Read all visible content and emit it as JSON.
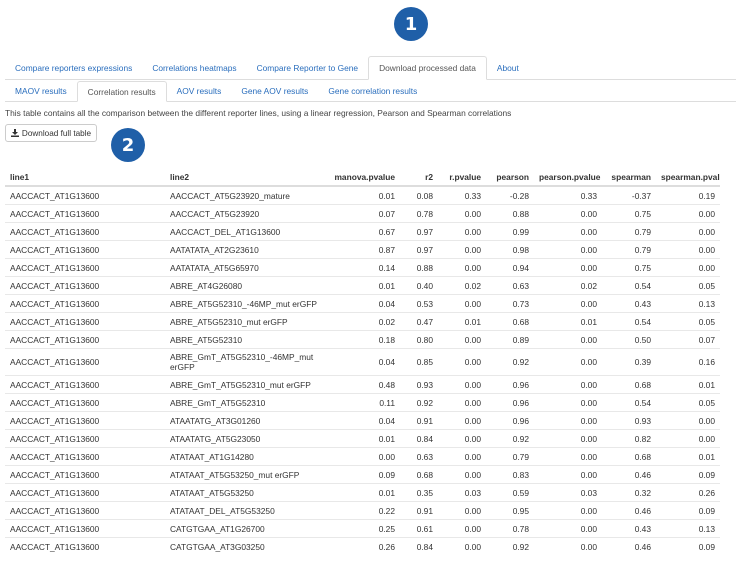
{
  "annotations": [
    "1",
    "2"
  ],
  "top_tabs": [
    {
      "label": "Compare reporters expressions",
      "active": false
    },
    {
      "label": "Correlations heatmaps",
      "active": false
    },
    {
      "label": "Compare Reporter to Gene",
      "active": false
    },
    {
      "label": "Download processed data",
      "active": true
    },
    {
      "label": "About",
      "active": false
    }
  ],
  "sub_tabs": [
    {
      "label": "MAOV results",
      "active": false
    },
    {
      "label": "Correlation results",
      "active": true
    },
    {
      "label": "AOV results",
      "active": false
    },
    {
      "label": "Gene AOV results",
      "active": false
    },
    {
      "label": "Gene correlation results",
      "active": false
    }
  ],
  "description": "This table contains all the comparison between the different reporter lines, using a linear regression, Pearson and Spearman correlations",
  "download_button": {
    "label": "Download full table",
    "icon": "download-icon"
  },
  "table": {
    "headers": [
      "line1",
      "line2",
      "manova.pvalue",
      "r2",
      "r.pvalue",
      "pearson",
      "pearson.pvalue",
      "spearman",
      "spearman.pvalue"
    ],
    "rows": [
      [
        "AACCACT_AT1G13600",
        "AACCACT_AT5G23920_mature",
        "0.01",
        "0.08",
        "0.33",
        "-0.28",
        "0.33",
        "-0.37",
        "0.19"
      ],
      [
        "AACCACT_AT1G13600",
        "AACCACT_AT5G23920",
        "0.07",
        "0.78",
        "0.00",
        "0.88",
        "0.00",
        "0.75",
        "0.00"
      ],
      [
        "AACCACT_AT1G13600",
        "AACCACT_DEL_AT1G13600",
        "0.67",
        "0.97",
        "0.00",
        "0.99",
        "0.00",
        "0.79",
        "0.00"
      ],
      [
        "AACCACT_AT1G13600",
        "AATATATA_AT2G23610",
        "0.87",
        "0.97",
        "0.00",
        "0.98",
        "0.00",
        "0.79",
        "0.00"
      ],
      [
        "AACCACT_AT1G13600",
        "AATATATA_AT5G65970",
        "0.14",
        "0.88",
        "0.00",
        "0.94",
        "0.00",
        "0.75",
        "0.00"
      ],
      [
        "AACCACT_AT1G13600",
        "ABRE_AT4G26080",
        "0.01",
        "0.40",
        "0.02",
        "0.63",
        "0.02",
        "0.54",
        "0.05"
      ],
      [
        "AACCACT_AT1G13600",
        "ABRE_AT5G52310_-46MP_mut erGFP",
        "0.04",
        "0.53",
        "0.00",
        "0.73",
        "0.00",
        "0.43",
        "0.13"
      ],
      [
        "AACCACT_AT1G13600",
        "ABRE_AT5G52310_mut erGFP",
        "0.02",
        "0.47",
        "0.01",
        "0.68",
        "0.01",
        "0.54",
        "0.05"
      ],
      [
        "AACCACT_AT1G13600",
        "ABRE_AT5G52310",
        "0.18",
        "0.80",
        "0.00",
        "0.89",
        "0.00",
        "0.50",
        "0.07"
      ],
      [
        "AACCACT_AT1G13600",
        "ABRE_GmT_AT5G52310_-46MP_mut erGFP",
        "0.04",
        "0.85",
        "0.00",
        "0.92",
        "0.00",
        "0.39",
        "0.16"
      ],
      [
        "AACCACT_AT1G13600",
        "ABRE_GmT_AT5G52310_mut erGFP",
        "0.48",
        "0.93",
        "0.00",
        "0.96",
        "0.00",
        "0.68",
        "0.01"
      ],
      [
        "AACCACT_AT1G13600",
        "ABRE_GmT_AT5G52310",
        "0.11",
        "0.92",
        "0.00",
        "0.96",
        "0.00",
        "0.54",
        "0.05"
      ],
      [
        "AACCACT_AT1G13600",
        "ATAATATG_AT3G01260",
        "0.04",
        "0.91",
        "0.00",
        "0.96",
        "0.00",
        "0.93",
        "0.00"
      ],
      [
        "AACCACT_AT1G13600",
        "ATAATATG_AT5G23050",
        "0.01",
        "0.84",
        "0.00",
        "0.92",
        "0.00",
        "0.82",
        "0.00"
      ],
      [
        "AACCACT_AT1G13600",
        "ATATAAT_AT1G14280",
        "0.00",
        "0.63",
        "0.00",
        "0.79",
        "0.00",
        "0.68",
        "0.01"
      ],
      [
        "AACCACT_AT1G13600",
        "ATATAAT_AT5G53250_mut erGFP",
        "0.09",
        "0.68",
        "0.00",
        "0.83",
        "0.00",
        "0.46",
        "0.09"
      ],
      [
        "AACCACT_AT1G13600",
        "ATATAAT_AT5G53250",
        "0.01",
        "0.35",
        "0.03",
        "0.59",
        "0.03",
        "0.32",
        "0.26"
      ],
      [
        "AACCACT_AT1G13600",
        "ATATAAT_DEL_AT5G53250",
        "0.22",
        "0.91",
        "0.00",
        "0.95",
        "0.00",
        "0.46",
        "0.09"
      ],
      [
        "AACCACT_AT1G13600",
        "CATGTGAA_AT1G26700",
        "0.25",
        "0.61",
        "0.00",
        "0.78",
        "0.00",
        "0.43",
        "0.13"
      ],
      [
        "AACCACT_AT1G13600",
        "CATGTGAA_AT3G03250",
        "0.26",
        "0.84",
        "0.00",
        "0.92",
        "0.00",
        "0.46",
        "0.09"
      ]
    ]
  },
  "colors": {
    "link": "#2a6ebd",
    "marker": "#1f5fa8",
    "border": "#dddddd"
  }
}
